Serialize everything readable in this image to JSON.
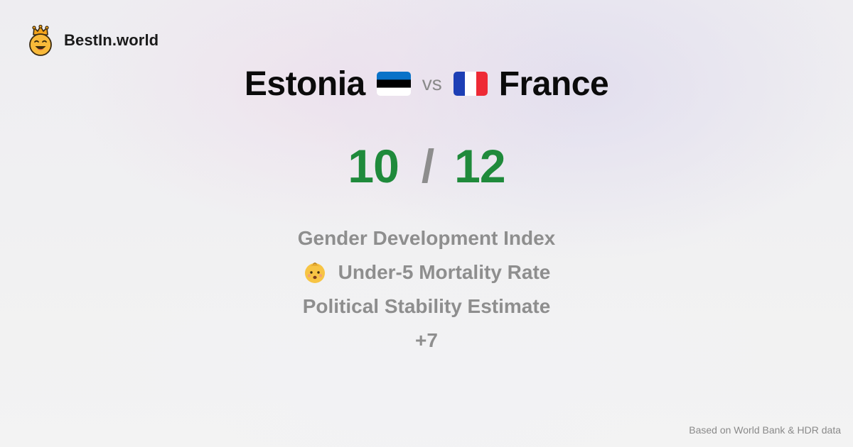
{
  "brand": {
    "name": "BestIn.world",
    "icon": "crowned-smiley-icon"
  },
  "comparison": {
    "left_country": "Estonia",
    "left_flag": "estonia-flag-icon",
    "vs_label": "vs",
    "right_country": "France",
    "right_flag": "france-flag-icon"
  },
  "score": {
    "left": "10",
    "separator": "/",
    "right": "12"
  },
  "metrics": {
    "items": [
      {
        "label": "Gender Development Index"
      },
      {
        "label": "Under-5 Mortality Rate",
        "icon": "baby-face-icon"
      },
      {
        "label": "Political Stability Estimate"
      }
    ],
    "more": "+7"
  },
  "footer": {
    "source": "Based on World Bank & HDR data"
  },
  "colors": {
    "score": "#1f8a3b",
    "muted_text": "#8e8e8e",
    "title_text": "#0b0b0b",
    "estonia_blue": "#0a72c8",
    "estonia_black": "#000000",
    "estonia_white": "#ffffff",
    "france_blue": "#1d3fb5",
    "france_white": "#ffffff",
    "france_red": "#ee2a35"
  }
}
